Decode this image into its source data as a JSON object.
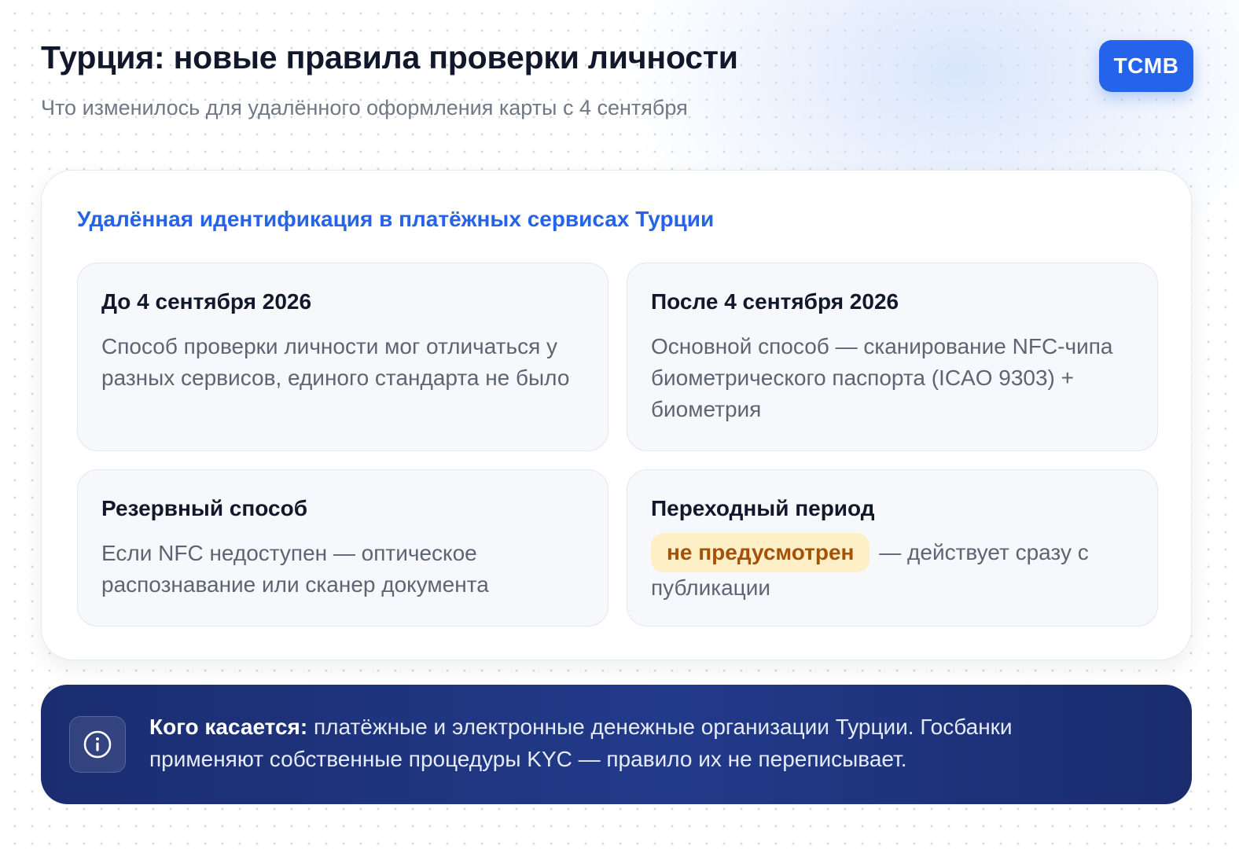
{
  "header": {
    "title": "Турция: новые правила проверки личности",
    "subtitle": "Что изменилось для удалённого оформления карты с 4 сентября",
    "brand": "TCMB"
  },
  "panel": {
    "title": "Удалённая идентификация в платёжных сервисах Турции",
    "cards": [
      {
        "title": "До 4 сентября 2026",
        "text": "Способ проверки личности мог отличаться у разных сервисов, единого стандарта не было"
      },
      {
        "title": "После 4 сентября 2026",
        "text": "Основной способ — сканирование NFC-чипа биометрического паспорта (ICAO 9303) + биометрия"
      },
      {
        "title": "Резервный способ",
        "text": "Если NFC недоступен — оптическое распознавание или сканер документа"
      },
      {
        "title": "Переходный период",
        "highlight": "не предусмотрен",
        "text": " — действует сразу с публикации"
      }
    ]
  },
  "notice": {
    "icon": "info-icon",
    "label": "Кого касается:",
    "text": " платёжные и электронные денежные организации Турции. Госбанки применяют собственные процедуры KYC — правило их не переписывает."
  },
  "colors": {
    "accent": "#2563eb",
    "highlight_bg": "#fdf0c6",
    "highlight_text": "#a55208",
    "notice_bg": "#1f3580"
  }
}
